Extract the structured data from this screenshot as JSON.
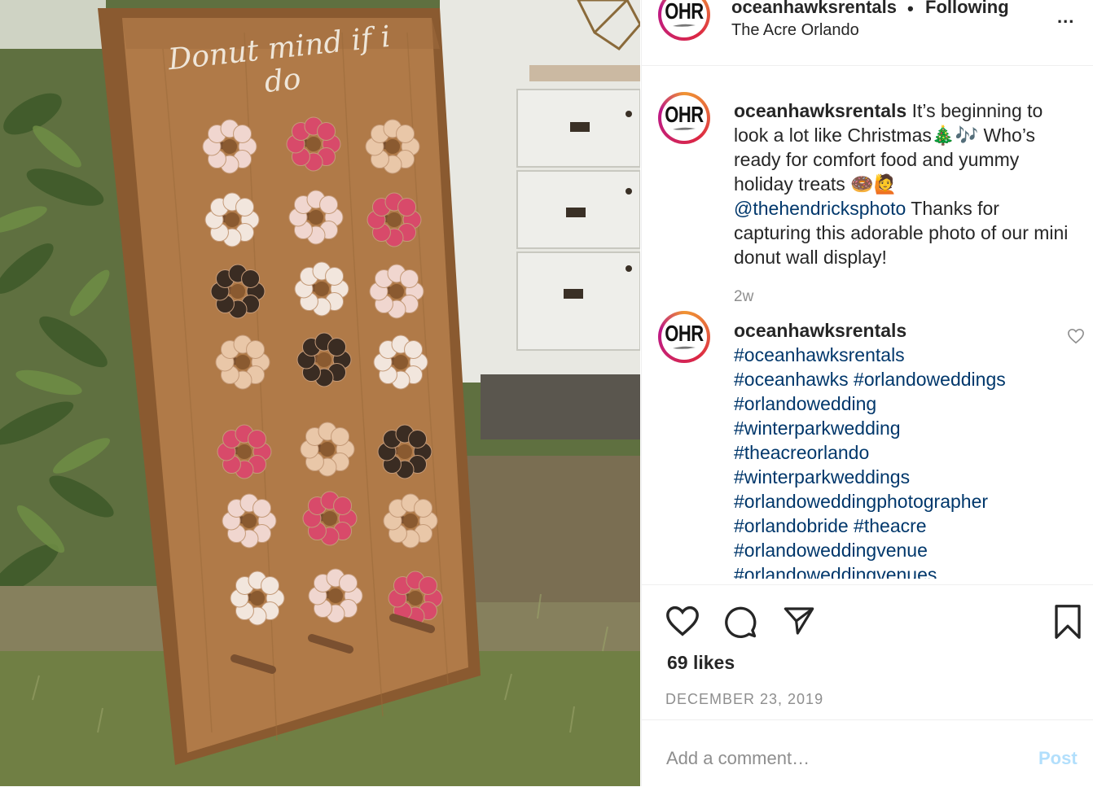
{
  "photo": {
    "sign_text": "Donut mind if i do"
  },
  "header": {
    "username": "oceanhawksrentals",
    "separator": "•",
    "follow_status": "Following",
    "location": "The Acre Orlando",
    "more_label": "..."
  },
  "avatar_text": "OHR",
  "caption": {
    "username": "oceanhawksrentals",
    "text_part1": " It’s beginning to look a lot like Christmas",
    "emoji1": "🎄🎶",
    "text_part2": " Who’s ready for comfort food and yummy holiday treats ",
    "emoji2": "🍩🙋",
    "mention": "@thehendricksphoto",
    "text_part3": " Thanks for capturing this adorable photo of our mini donut wall display!",
    "time": "2w"
  },
  "hashtag_comment": {
    "username": "oceanhawksrentals",
    "tags": [
      "#oceanhawksrentals",
      "#oceanhawks #orlandoweddings",
      "#orlandowedding",
      "#winterparkwedding",
      "#theacreorlando",
      "#winterparkweddings",
      "#orlandoweddingphotographer",
      "#orlandobride #theacre",
      "#orlandoweddingvenue",
      "#orlandoweddingvenues"
    ]
  },
  "actions": {
    "likes": "69 likes",
    "date": "DECEMBER 23, 2019"
  },
  "comment_box": {
    "placeholder": "Add a comment…",
    "post_label": "Post"
  }
}
